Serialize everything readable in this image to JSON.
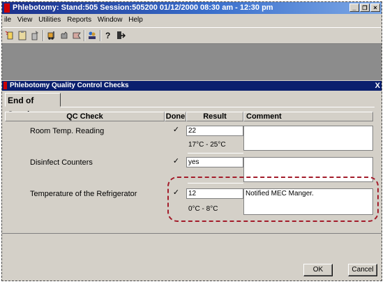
{
  "window": {
    "title": "Phlebotomy: Stand:505 Session:505200 01/12/2000 08:30 am - 12:30 pm",
    "controls": [
      "_",
      "é",
      "×"
    ]
  },
  "menu": [
    "File",
    "View",
    "Utilities",
    "Reports",
    "Window",
    "Help"
  ],
  "menu_display": [
    "ile",
    "View",
    "Utilities",
    "Reports",
    "Window",
    "Help"
  ],
  "toolbar_icons": [
    "new-icon",
    "clipboard-icon",
    "document-icon",
    "forklift-icon",
    "hand-icon",
    "flag-icon",
    "people-icon",
    "help-icon",
    "exit-icon"
  ],
  "dialog": {
    "title": "Phlebotomy Quality Control Checks",
    "close": "X",
    "tab": "End of Session",
    "columns": {
      "qc_check": "QC Check",
      "done": "Done",
      "result": "Result",
      "comment": "Comment"
    },
    "rows": [
      {
        "check": "Room Temp. Reading",
        "done": "✓",
        "result": "22",
        "range": "17°C - 25°C",
        "comment": ""
      },
      {
        "check": "Disinfect Counters",
        "done": "✓",
        "result": "yes",
        "range": "",
        "comment": ""
      },
      {
        "check": "Temperature of the Refrigerator",
        "done": "✓",
        "result": "12",
        "range": "0°C - 8°C",
        "comment": "Notified MEC Manger."
      }
    ],
    "buttons": {
      "ok": "OK",
      "cancel": "Cancel"
    }
  },
  "colors": {
    "title_bar": "#1a2f8a",
    "dialog_title_bar": "#0a1f6e",
    "highlight_ring": "#a31c2a",
    "face": "#d4d0c8"
  }
}
